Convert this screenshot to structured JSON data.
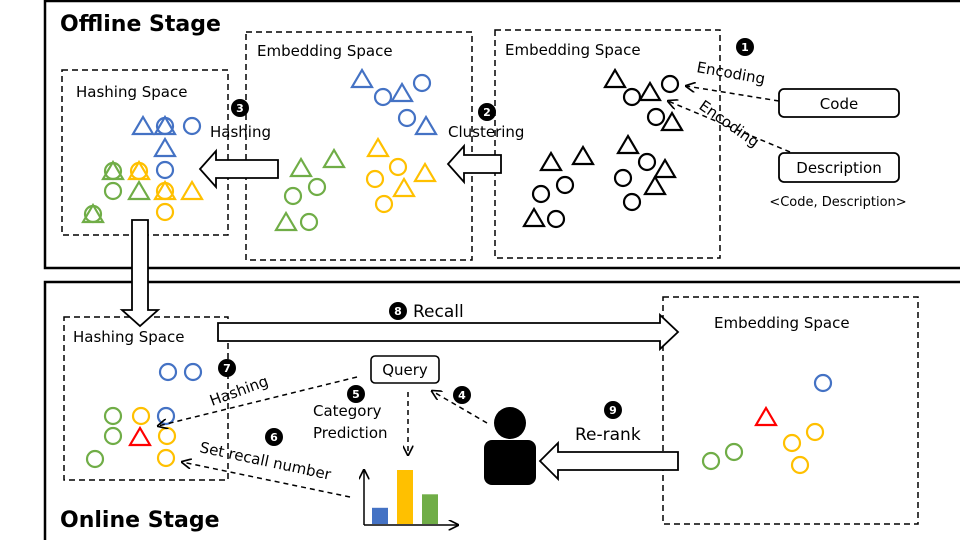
{
  "offline": {
    "title": "Offline Stage",
    "hashing_space": "Hashing Space",
    "embedding_space_mid": "Embedding Space",
    "embedding_space_right": "Embedding Space",
    "step1": "1",
    "encoding1": "Encoding",
    "encoding2": "Encoding",
    "code": "Code",
    "description": "Description",
    "pair": "<Code, Description>",
    "step2": "2",
    "clustering": "Clustering",
    "step3": "3",
    "hashing": "Hashing"
  },
  "online": {
    "title": "Online Stage",
    "hashing_space": "Hashing Space",
    "embedding_space": "Embedding Space",
    "step8": "8",
    "recall": "Recall",
    "step7": "7",
    "hashing": "Hashing",
    "query": "Query",
    "step4": "4",
    "step5": "5",
    "category_prediction_1": "Category",
    "category_prediction_2": "Prediction",
    "step6": "6",
    "set_recall_number": "Set recall number",
    "step9": "9",
    "rerank": "Re-rank",
    "chart_bars": [
      {
        "color": "#4472C4",
        "value": 0.3
      },
      {
        "color": "#FFC000",
        "value": 1.0
      },
      {
        "color": "#70AD47",
        "value": 0.55
      }
    ]
  },
  "colors": {
    "blue": "#4472C4",
    "green": "#70AD47",
    "yellow": "#FFC000",
    "red": "#FF0000",
    "black": "#000000"
  }
}
